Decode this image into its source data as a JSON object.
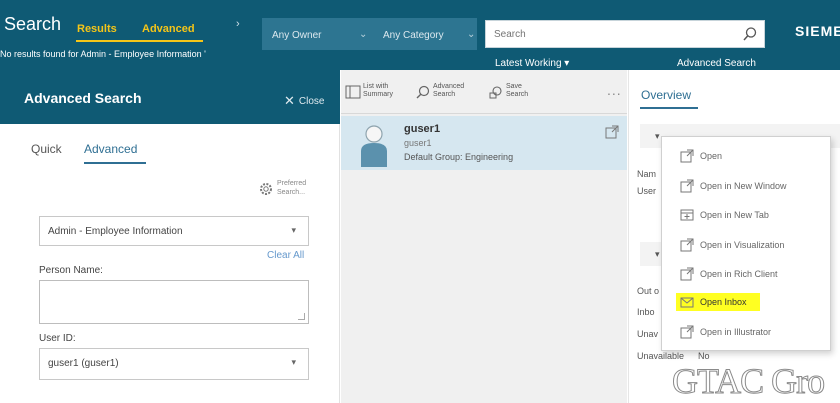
{
  "header": {
    "title": "Search",
    "tabs": [
      "Results",
      "Advanced"
    ],
    "status": "No results found for Admin - Employee Information '",
    "owner_dropdown": "Any Owner",
    "category_dropdown": "Any Category",
    "search_placeholder": "Search",
    "brand": "SIEMENS",
    "latest_working": "Latest Working ▾",
    "advanced_search_link": "Advanced Search"
  },
  "left_panel": {
    "title": "Advanced Search",
    "close_label": "Close",
    "tabs": [
      "Quick",
      "Advanced"
    ],
    "preferred_search": [
      "Preferred",
      "Search..."
    ],
    "query_class": "Admin - Employee Information",
    "clear_all": "Clear All",
    "person_name_label": "Person Name:",
    "person_name_value": "",
    "user_id_label": "User ID:",
    "user_id_value": "guser1 (guser1)"
  },
  "toolbar": {
    "list_with_summary": [
      "List with",
      "Summary"
    ],
    "advanced_search": [
      "Advanced",
      "Search"
    ],
    "save_search": [
      "Save",
      "Search"
    ],
    "more": "..."
  },
  "result": {
    "name": "guser1",
    "id": "guser1",
    "group": "Default Group: Engineering"
  },
  "right_panel": {
    "tab": "Overview",
    "section_labels": [
      "Nam",
      "User",
      "Out o",
      "Inbo",
      "Unav",
      "Unavailable"
    ],
    "section_value": "No"
  },
  "context_menu": {
    "items": [
      {
        "label": "Open",
        "icon": "open-icon"
      },
      {
        "label": "Open in New Window",
        "icon": "open-icon"
      },
      {
        "label": "Open in New Tab",
        "icon": "new-tab-icon"
      },
      {
        "label": "Open in Visualization",
        "icon": "open-icon"
      },
      {
        "label": "Open in Rich Client",
        "icon": "open-icon"
      },
      {
        "label": "Open Inbox",
        "icon": "inbox-icon",
        "highlighted": true
      },
      {
        "label": "Open in Illustrator",
        "icon": "open-icon"
      }
    ]
  },
  "watermark": "GTAC Gro",
  "colors": {
    "header": "#0f5a74",
    "tab_accent": "#f5c518",
    "link": "#2f6f93",
    "highlight": "#ffff22",
    "selected_row": "#d6e7f0"
  }
}
